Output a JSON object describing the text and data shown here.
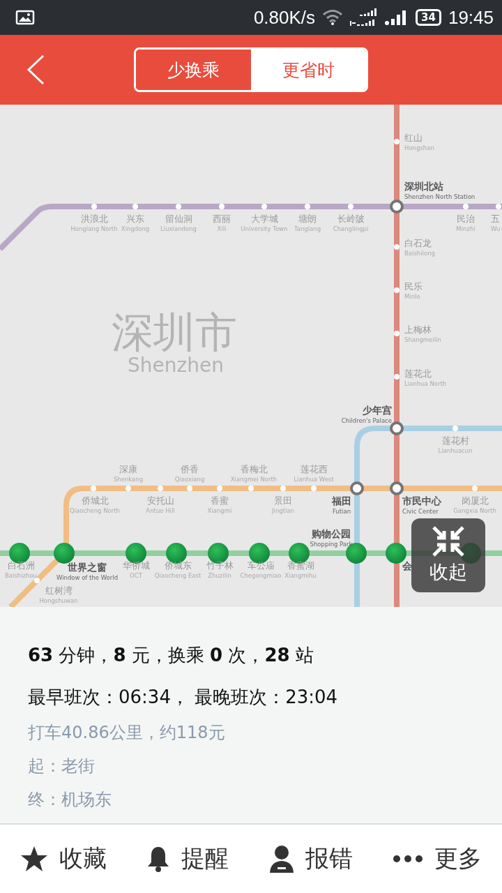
{
  "status_bar": {
    "speed": "0.80K/s",
    "battery": "34",
    "time": "19:45"
  },
  "header": {
    "tabs": [
      {
        "label": "少换乘",
        "selected": true
      },
      {
        "label": "更省时",
        "selected": false
      }
    ]
  },
  "map": {
    "city": "深圳市",
    "city_en": "Shenzhen",
    "collapse_button": "收起",
    "stations": [
      {
        "name": "红山",
        "name_en": "Hongshan",
        "kind": "stop"
      },
      {
        "name": "深圳北站",
        "name_en": "Shenzhen North Station",
        "kind": "interchange"
      },
      {
        "name": "洪浪北",
        "name_en": "Honglang North",
        "kind": "stop"
      },
      {
        "name": "兴东",
        "name_en": "Xingdong",
        "kind": "stop"
      },
      {
        "name": "留仙洞",
        "name_en": "Liuxiandong",
        "kind": "stop"
      },
      {
        "name": "西丽",
        "name_en": "Xili",
        "kind": "stop"
      },
      {
        "name": "大学城",
        "name_en": "University Town",
        "kind": "stop"
      },
      {
        "name": "塘朗",
        "name_en": "Tanglang",
        "kind": "stop"
      },
      {
        "name": "长岭陂",
        "name_en": "Changlingpi",
        "kind": "stop"
      },
      {
        "name": "民治",
        "name_en": "Minzhi",
        "kind": "stop"
      },
      {
        "name": "五",
        "name_en": "Wu",
        "kind": "stop"
      },
      {
        "name": "白石龙",
        "name_en": "Baishilong",
        "kind": "stop"
      },
      {
        "name": "民乐",
        "name_en": "Minle",
        "kind": "stop"
      },
      {
        "name": "上梅林",
        "name_en": "Shangmeilin",
        "kind": "stop"
      },
      {
        "name": "莲花北",
        "name_en": "Lianhua North",
        "kind": "stop"
      },
      {
        "name": "少年宫",
        "name_en": "Children's Palace",
        "kind": "interchange"
      },
      {
        "name": "莲花村",
        "name_en": "Lianhuacun",
        "kind": "stop"
      },
      {
        "name": "深康",
        "name_en": "Shenkang",
        "kind": "stop"
      },
      {
        "name": "侨香",
        "name_en": "Qiaoxiang",
        "kind": "stop"
      },
      {
        "name": "香梅北",
        "name_en": "Xiangmei North",
        "kind": "stop"
      },
      {
        "name": "莲花西",
        "name_en": "Lianhua West",
        "kind": "stop"
      },
      {
        "name": "侨城北",
        "name_en": "Qiaocheng North",
        "kind": "stop"
      },
      {
        "name": "安托山",
        "name_en": "Antuo Hill",
        "kind": "stop"
      },
      {
        "name": "香蜜",
        "name_en": "Xiangmi",
        "kind": "stop"
      },
      {
        "name": "景田",
        "name_en": "Jingtian",
        "kind": "stop"
      },
      {
        "name": "福田",
        "name_en": "Futian",
        "kind": "interchange"
      },
      {
        "name": "市民中心",
        "name_en": "Civic Center",
        "kind": "interchange"
      },
      {
        "name": "岗厦北",
        "name_en": "Gangxia North",
        "kind": "stop"
      },
      {
        "name": "红树湾",
        "name_en": "Hongshuwan",
        "kind": "stop"
      },
      {
        "name": "白石洲",
        "name_en": "Baishizhou",
        "kind": "route"
      },
      {
        "name": "世界之窗",
        "name_en": "Window of the World",
        "kind": "route-interchange"
      },
      {
        "name": "华侨城",
        "name_en": "OCT",
        "kind": "route"
      },
      {
        "name": "侨城东",
        "name_en": "Qiaocheng East",
        "kind": "route"
      },
      {
        "name": "竹子林",
        "name_en": "Zhuzilin",
        "kind": "route"
      },
      {
        "name": "车公庙",
        "name_en": "Chegongmiao",
        "kind": "route"
      },
      {
        "name": "香蜜湖",
        "name_en": "Xiangmihu",
        "kind": "route"
      },
      {
        "name": "购物公园",
        "name_en": "Shopping Park",
        "kind": "route-interchange"
      },
      {
        "name": "会",
        "kind": "route-interchange"
      },
      {
        "kind": "route"
      }
    ]
  },
  "summary": {
    "stats": "**63** 分钟，**8** 元，换乘 **0** 次，**28** 站",
    "schedule": "最早班次：06:34， 最晚班次：23:04",
    "taxi": "打车40.86公里，约118元",
    "origin": "起：老街",
    "destination": "终：机场东"
  },
  "actions": [
    {
      "label": "收藏",
      "kind": "star"
    },
    {
      "label": "提醒",
      "kind": "bell"
    },
    {
      "label": "报错",
      "kind": "person"
    },
    {
      "label": "更多",
      "kind": "more"
    }
  ]
}
